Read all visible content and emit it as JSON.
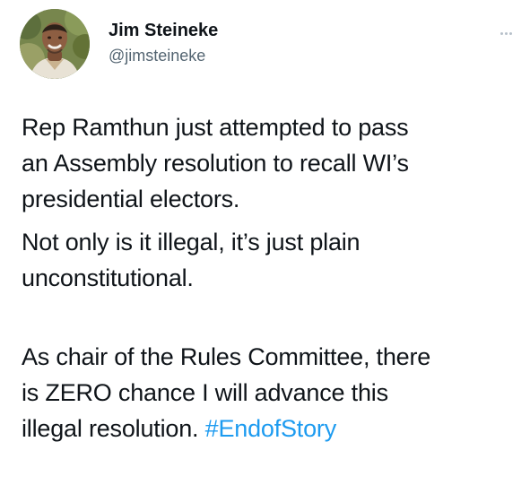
{
  "tweet": {
    "author": {
      "display_name": "Jim Steineke",
      "handle": "@jimsteineke",
      "avatar_icon": "profile-photo"
    },
    "more_icon": "more-options-icon",
    "paragraphs": [
      "Rep Ramthun just attempted to pass\nan Assembly resolution to recall WI’s\npresidential electors.",
      "Not only is it illegal, it’s just plain\nunconstitutional."
    ],
    "final_paragraph": {
      "text": "As chair of the Rules Committee, there\nis ZERO chance I will advance this\nillegal resolution. ",
      "hashtag": "#EndofStory"
    }
  },
  "colors": {
    "text": "#0f1419",
    "secondary_text": "#536471",
    "link": "#1d9bf0",
    "background": "#ffffff"
  }
}
